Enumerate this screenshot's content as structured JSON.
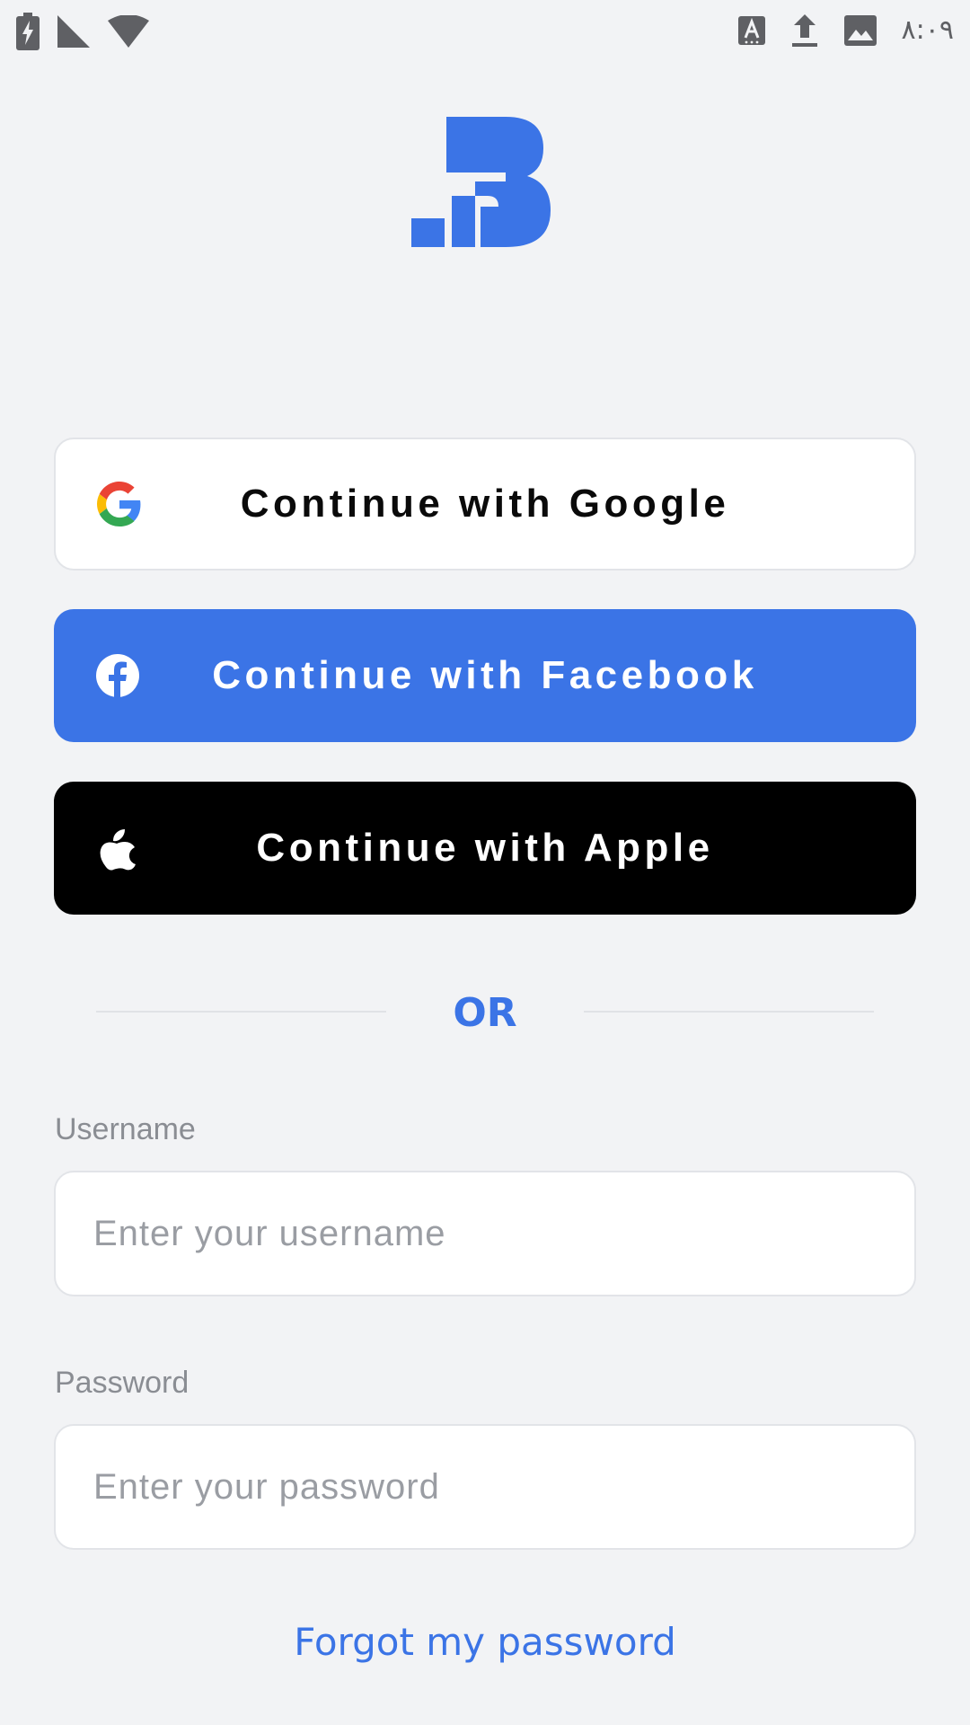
{
  "status_bar": {
    "time": "۸:۰۹",
    "left_icons": [
      "battery-charging-icon",
      "cell-signal-icon",
      "wifi-icon"
    ],
    "right_icons": [
      "keyboard-a-icon",
      "upload-icon",
      "image-icon"
    ]
  },
  "brand": {
    "logo": "brand-logo",
    "accent_color": "#3b74e6"
  },
  "social": {
    "google_label": "Continue with Google",
    "facebook_label": "Continue with Facebook",
    "apple_label": "Continue with Apple",
    "google_icon": "google-icon",
    "facebook_icon": "facebook-icon",
    "apple_icon": "apple-icon"
  },
  "divider": {
    "text": "OR"
  },
  "form": {
    "username_label": "Username",
    "username_placeholder": "Enter your username",
    "username_value": "",
    "password_label": "Password",
    "password_placeholder": "Enter your password",
    "password_value": ""
  },
  "links": {
    "forgot_password": "Forgot my password"
  }
}
